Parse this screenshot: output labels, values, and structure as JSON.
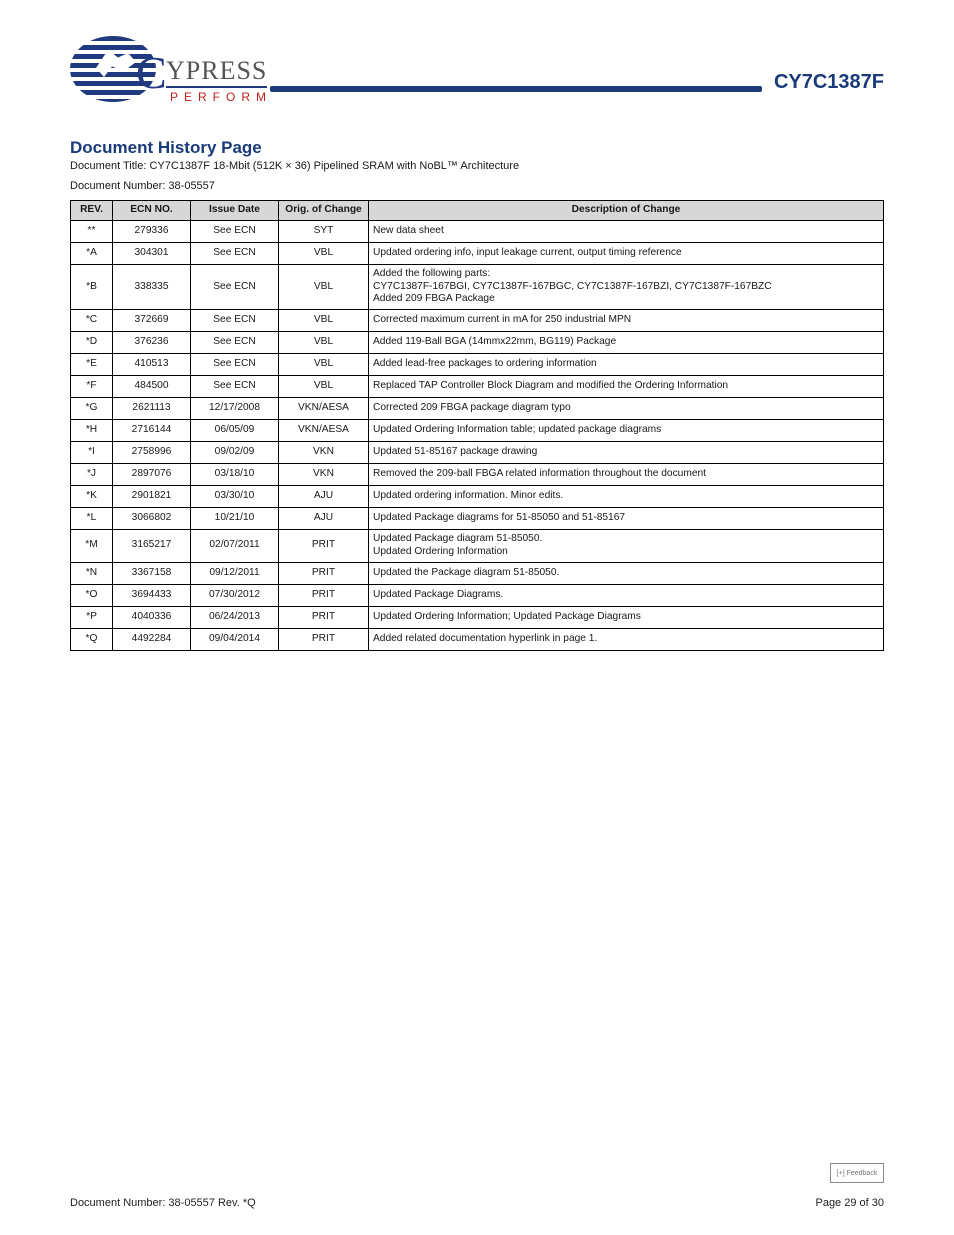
{
  "header": {
    "logo_main": "YPRESS",
    "logo_tag": "PERFORM",
    "part_number": "CY7C1387F"
  },
  "history": {
    "title": "Document History Page",
    "doc_title_line": "Document Title: CY7C1387F 18-Mbit (512K × 36) Pipelined SRAM with NoBL™ Architecture",
    "doc_number_line": "Document Number: 38-05557",
    "columns": [
      "REV.",
      "ECN NO.",
      "Issue Date",
      "Orig. of Change",
      "Description of Change"
    ],
    "rows": [
      {
        "rev": "**",
        "ecn": "279336",
        "date": "See ECN",
        "ooc": "SYT",
        "desc": "New data sheet"
      },
      {
        "rev": "*A",
        "ecn": "304301",
        "date": "See ECN",
        "ooc": "VBL",
        "desc": "Updated ordering info, input leakage current, output timing reference"
      },
      {
        "rev": "*B",
        "ecn": "338335",
        "date": "See ECN",
        "ooc": "VBL",
        "desc": "Added the following parts:\nCY7C1387F-167BGI, CY7C1387F-167BGC, CY7C1387F-167BZI, CY7C1387F-167BZC\nAdded 209 FBGA Package"
      },
      {
        "rev": "*C",
        "ecn": "372669",
        "date": "See ECN",
        "ooc": "VBL",
        "desc": "Corrected maximum current in mA for 250 industrial MPN"
      },
      {
        "rev": "*D",
        "ecn": "376236",
        "date": "See ECN",
        "ooc": "VBL",
        "desc": "Added 119-Ball BGA (14mmx22mm, BG119) Package"
      },
      {
        "rev": "*E",
        "ecn": "410513",
        "date": "See ECN",
        "ooc": "VBL",
        "desc": "Added lead-free packages to ordering information"
      },
      {
        "rev": "*F",
        "ecn": "484500",
        "date": "See ECN",
        "ooc": "VBL",
        "desc": "Replaced TAP Controller Block Diagram and modified the Ordering Information"
      },
      {
        "rev": "*G",
        "ecn": "2621113",
        "date": "12/17/2008",
        "ooc": "VKN/AESA",
        "desc": "Corrected 209 FBGA package diagram typo"
      },
      {
        "rev": "*H",
        "ecn": "2716144",
        "date": "06/05/09",
        "ooc": "VKN/AESA",
        "desc": "Updated Ordering Information table; updated package diagrams"
      },
      {
        "rev": "*I",
        "ecn": "2758996",
        "date": "09/02/09",
        "ooc": "VKN",
        "desc": "Updated 51-85167 package drawing"
      },
      {
        "rev": "*J",
        "ecn": "2897076",
        "date": "03/18/10",
        "ooc": "VKN",
        "desc": "Removed the 209-ball FBGA related information throughout the document"
      },
      {
        "rev": "*K",
        "ecn": "2901821",
        "date": "03/30/10",
        "ooc": "AJU",
        "desc": "Updated ordering information. Minor edits."
      },
      {
        "rev": "*L",
        "ecn": "3066802",
        "date": "10/21/10",
        "ooc": "AJU",
        "desc": "Updated Package diagrams for 51-85050 and 51-85167"
      },
      {
        "rev": "*M",
        "ecn": "3165217",
        "date": "02/07/2011",
        "ooc": "PRIT",
        "desc": "Updated Package diagram 51-85050.\nUpdated Ordering Information"
      },
      {
        "rev": "*N",
        "ecn": "3367158",
        "date": "09/12/2011",
        "ooc": "PRIT",
        "desc": "Updated the Package diagram 51-85050."
      },
      {
        "rev": "*O",
        "ecn": "3694433",
        "date": "07/30/2012",
        "ooc": "PRIT",
        "desc": "Updated Package Diagrams."
      },
      {
        "rev": "*P",
        "ecn": "4040336",
        "date": "06/24/2013",
        "ooc": "PRIT",
        "desc": "Updated Ordering Information; Updated Package Diagrams"
      },
      {
        "rev": "*Q",
        "ecn": "4492284",
        "date": "09/04/2014",
        "ooc": "PRIT",
        "desc": "Added related documentation hyperlink in page 1."
      }
    ]
  },
  "footer": {
    "left": "Document Number: 38-05557 Rev. *Q",
    "right": "Page 29 of 30",
    "tinybox": "[+] Feedback"
  }
}
